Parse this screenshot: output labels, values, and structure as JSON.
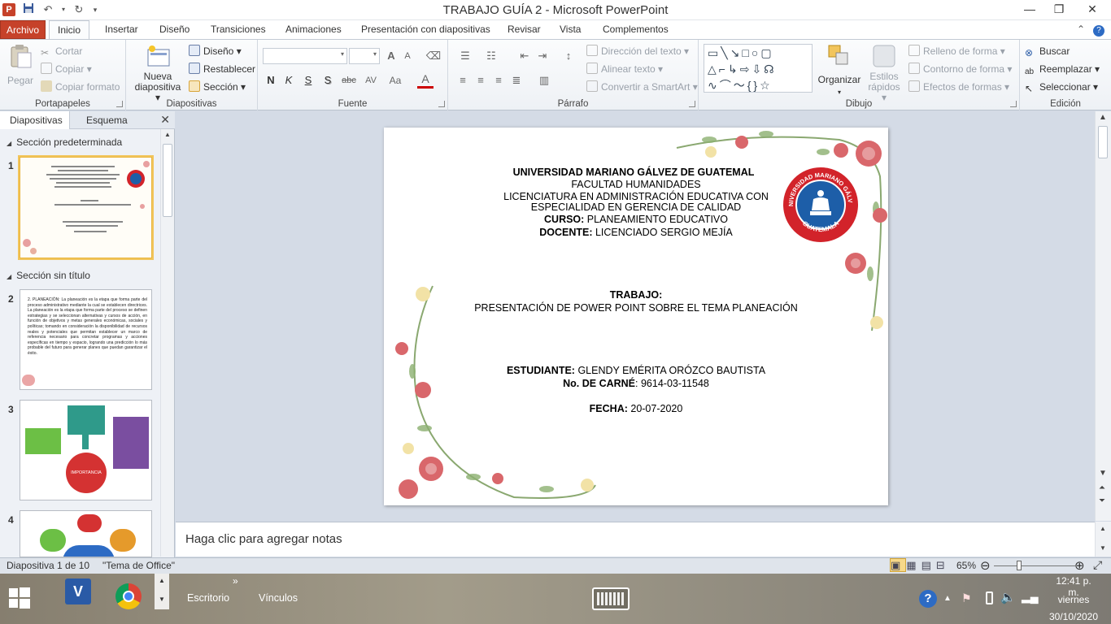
{
  "window": {
    "title": "TRABAJO GUÍA 2  -  Microsoft PowerPoint",
    "app_letter": "P"
  },
  "tabs": {
    "file": "Archivo",
    "items": [
      "Inicio",
      "Insertar",
      "Diseño",
      "Transiciones",
      "Animaciones",
      "Presentación con diapositivas",
      "Revisar",
      "Vista",
      "Complementos"
    ],
    "active": "Inicio"
  },
  "ribbon": {
    "clipboard": {
      "label": "Portapapeles",
      "paste": "Pegar",
      "cut": "Cortar",
      "copy": "Copiar",
      "format_painter": "Copiar formato"
    },
    "slides": {
      "label": "Diapositivas",
      "new_slide_line1": "Nueva",
      "new_slide_line2": "diapositiva",
      "layout": "Diseño",
      "reset": "Restablecer",
      "section": "Sección"
    },
    "font": {
      "label": "Fuente",
      "bold": "N",
      "italic": "K",
      "underline": "S",
      "shadow": "S",
      "strike": "abc",
      "spacing": "AV",
      "case": "Aa",
      "grow": "A",
      "shrink": "A",
      "color": "A"
    },
    "paragraph": {
      "label": "Párrafo",
      "text_direction": "Dirección del texto",
      "align_text": "Alinear texto",
      "smartart": "Convertir a SmartArt"
    },
    "drawing": {
      "label": "Dibujo",
      "arrange": "Organizar",
      "quick_styles_line1": "Estilos",
      "quick_styles_line2": "rápidos",
      "shape_fill": "Relleno de forma",
      "shape_outline": "Contorno de forma",
      "shape_effects": "Efectos de formas"
    },
    "editing": {
      "label": "Edición",
      "find": "Buscar",
      "replace": "Reemplazar",
      "select": "Seleccionar"
    }
  },
  "left_pane": {
    "tab_slides": "Diapositivas",
    "tab_outline": "Esquema",
    "section1": "Sección predeterminada",
    "section2": "Sección sin título",
    "slide_numbers": [
      "1",
      "2",
      "3",
      "4"
    ],
    "thumb2_text": "2. PLANEACIÓN: La planeación es la etapa que forma parte del proceso administrativo mediante la cual se establecen directrices. La planeación es la etapa que forma parte del proceso se definen estrategias y se seleccionan alternativas y cursos de acción, en función de objetivos y metas generales económicas, sociales y políticas; tomando en consideración la disponibilidad de recursos reales y potenciales que permitan establecer un marco de referencia necesario para concretar programas y acciones específicas en tiempo y espacio, logrando una predicción lo más probable del futuro para generar planes que puedan garantizar el éxito.",
    "thumb3_center": "IMPORTANCIA"
  },
  "slide": {
    "line1": "UNIVERSIDAD MARIANO GÁLVEZ DE GUATEMAL",
    "line2": "FACULTAD HUMANIDADES",
    "line3": "LICENCIATURA  EN ADMINISTRACIÓN  EDUCATIVA CON",
    "line4": "ESPECIALIDAD EN GERENCIA DE CALIDAD",
    "curso_label": "CURSO:",
    "curso_value": " PLANEAMIENTO EDUCATIVO",
    "docente_label": "DOCENTE:",
    "docente_value": "  LICENCIADO  SERGIO  MEJÍA",
    "trabajo_label": "TRABAJO:",
    "trabajo_value": "PRESENTACIÓN  DE POWER POINT SOBRE EL TEMA PLANEACIÓN",
    "estudiante_label": "ESTUDIANTE:",
    "estudiante_value": " GLENDY EMÉRITA ORÓZCO  BAUTISTA",
    "carne_label": "No. DE CARNÉ",
    "carne_value": ":  9614-03-11548",
    "fecha_label": "FECHA:",
    "fecha_value": " 20-07-2020",
    "logo_top": "UNIVERSIDAD MARIANO GÁLVEZ",
    "logo_bottom": "GUATEMALA"
  },
  "notes": {
    "placeholder": "Haga clic para agregar notas"
  },
  "status": {
    "slide_info": "Diapositiva 1 de 10",
    "theme": "\"Tema de Office\"",
    "zoom": "65%"
  },
  "taskbar": {
    "escritorio": "Escritorio",
    "vinculos": "Vínculos",
    "time": "12:41 p. m.",
    "day": "viernes",
    "date": "30/10/2020",
    "chevron": "»"
  },
  "colors": {
    "file_tab": "#c6422a",
    "selection": "#f2c55c",
    "logo_red": "#d2232a",
    "logo_blue": "#1d5ea8"
  }
}
